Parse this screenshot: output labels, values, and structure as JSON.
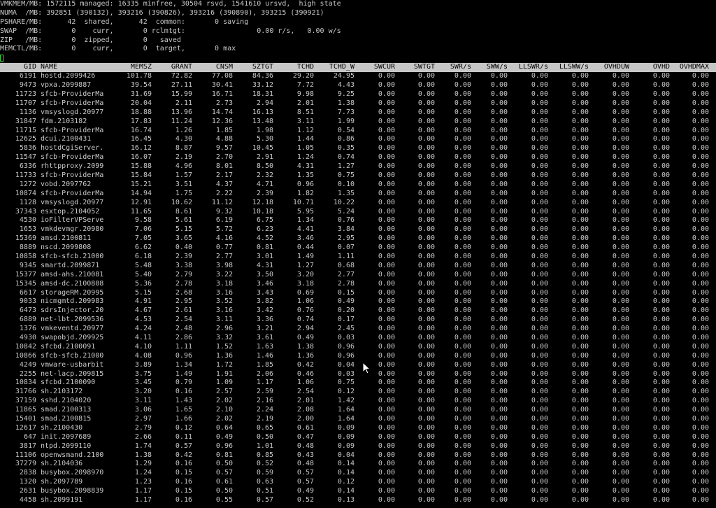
{
  "summary": [
    "VMKMEM/MB: 1572115 managed: 16335 minfree, 30504 rsvd, 1541610 ursvd,  high state",
    "NUMA  /MB: 392851 (390132), 393216 (390826), 393216 (390890), 393215 (390921)",
    "PSHARE/MB:      42  shared,      42  common:       0 saving",
    "SWAP  /MB:       0    curr,       0 rclmtgt:                 0.00 r/s,   0.00 w/s",
    "ZIP   /MB:       0  zipped,       0   saved",
    "MEMCTL/MB:       0    curr,       0  target,       0 max"
  ],
  "columns": [
    "GID",
    "NAME",
    "MEMSZ",
    "GRANT",
    "CNSM",
    "SZTGT",
    "TCHD",
    "TCHD_W",
    "SWCUR",
    "SWTGT",
    "SWR/s",
    "SWW/s",
    "LLSWR/s",
    "LLSWW/s",
    "OVHDUW",
    "OVHD",
    "OVHDMAX"
  ],
  "rows": [
    [
      "6191",
      "hostd.2099426",
      "101.78",
      "72.82",
      "77.08",
      "84.36",
      "29.20",
      "24.95"
    ],
    [
      "9473",
      "vpxa.2099887",
      "39.54",
      "27.11",
      "30.41",
      "33.12",
      "7.72",
      "4.43"
    ],
    [
      "11723",
      "sfcb-ProviderMa",
      "31.69",
      "15.99",
      "16.71",
      "18.31",
      "9.98",
      "9.25"
    ],
    [
      "11707",
      "sfcb-ProviderMa",
      "20.04",
      "2.11",
      "2.73",
      "2.94",
      "2.01",
      "1.38"
    ],
    [
      "1136",
      "vmsyslogd.20977",
      "18.88",
      "13.96",
      "14.74",
      "16.13",
      "8.51",
      "7.73"
    ],
    [
      "31847",
      "fdm.2103182",
      "17.83",
      "11.24",
      "12.36",
      "13.48",
      "3.11",
      "1.99"
    ],
    [
      "11715",
      "sfcb-ProviderMa",
      "16.74",
      "1.26",
      "1.85",
      "1.98",
      "1.12",
      "0.54"
    ],
    [
      "12625",
      "dcui.2100431",
      "16.45",
      "4.30",
      "4.88",
      "5.30",
      "1.44",
      "0.86"
    ],
    [
      "5836",
      "hostdCgiServer.",
      "16.12",
      "8.87",
      "9.57",
      "10.45",
      "1.05",
      "0.35"
    ],
    [
      "11547",
      "sfcb-ProviderMa",
      "16.07",
      "2.19",
      "2.70",
      "2.91",
      "1.24",
      "0.74"
    ],
    [
      "6336",
      "rhttpproxy.2099",
      "15.88",
      "4.96",
      "8.01",
      "8.50",
      "4.31",
      "1.27"
    ],
    [
      "11733",
      "sfcb-ProviderMa",
      "15.84",
      "1.57",
      "2.17",
      "2.32",
      "1.35",
      "0.75"
    ],
    [
      "1272",
      "vobd.2097762",
      "15.21",
      "3.51",
      "4.37",
      "4.71",
      "0.96",
      "0.10"
    ],
    [
      "10874",
      "sfcb-ProviderMa",
      "14.94",
      "1.75",
      "2.22",
      "2.39",
      "1.82",
      "1.35"
    ],
    [
      "1128",
      "vmsyslogd.20977",
      "12.91",
      "10.62",
      "11.12",
      "12.18",
      "10.71",
      "10.22"
    ],
    [
      "37343",
      "esxtop.2104052",
      "11.65",
      "8.61",
      "9.32",
      "10.18",
      "5.95",
      "5.24"
    ],
    [
      "4530",
      "ioFilterVPServe",
      "9.58",
      "5.61",
      "6.19",
      "6.75",
      "1.34",
      "0.76"
    ],
    [
      "1653",
      "vmkdevmgr.20980",
      "7.06",
      "5.15",
      "5.72",
      "6.23",
      "4.41",
      "3.84"
    ],
    [
      "15369",
      "amsd.2100811",
      "7.05",
      "3.65",
      "4.16",
      "4.52",
      "3.46",
      "2.95"
    ],
    [
      "8889",
      "nscd.2099808",
      "6.62",
      "0.40",
      "0.77",
      "0.81",
      "0.44",
      "0.07"
    ],
    [
      "10858",
      "sfcb-sfcb.21000",
      "6.18",
      "2.39",
      "2.77",
      "3.01",
      "1.49",
      "1.11"
    ],
    [
      "9345",
      "smartd.2099871",
      "5.48",
      "3.38",
      "3.98",
      "4.31",
      "1.27",
      "0.68"
    ],
    [
      "15377",
      "amsd-ahs.210081",
      "5.40",
      "2.79",
      "3.22",
      "3.50",
      "3.20",
      "2.77"
    ],
    [
      "15345",
      "amsd-dc.2100808",
      "5.36",
      "2.78",
      "3.18",
      "3.46",
      "3.18",
      "2.78"
    ],
    [
      "6617",
      "storageRM.20995",
      "5.15",
      "2.68",
      "3.16",
      "3.43",
      "0.69",
      "0.15"
    ],
    [
      "9033",
      "nicmgmtd.209983",
      "4.91",
      "2.95",
      "3.52",
      "3.82",
      "1.06",
      "0.49"
    ],
    [
      "6473",
      "sdrsInjector.20",
      "4.67",
      "2.61",
      "3.16",
      "3.42",
      "0.76",
      "0.20"
    ],
    [
      "6889",
      "net-lbt.2099536",
      "4.53",
      "2.54",
      "3.11",
      "3.36",
      "0.74",
      "0.17"
    ],
    [
      "1376",
      "vmkeventd.20977",
      "4.24",
      "2.48",
      "2.96",
      "3.21",
      "2.94",
      "2.45"
    ],
    [
      "4930",
      "swapobjd.209925",
      "4.11",
      "2.86",
      "3.32",
      "3.61",
      "0.49",
      "0.03"
    ],
    [
      "10842",
      "sfcbd.2100091",
      "4.10",
      "1.11",
      "1.52",
      "1.63",
      "1.38",
      "0.96"
    ],
    [
      "10866",
      "sfcb-sfcb.21000",
      "4.08",
      "0.96",
      "1.36",
      "1.46",
      "1.36",
      "0.96"
    ],
    [
      "4249",
      "vmware-usbarbit",
      "3.89",
      "1.34",
      "1.72",
      "1.85",
      "0.42",
      "0.04"
    ],
    [
      "2255",
      "net-lacp.209815",
      "3.75",
      "1.49",
      "1.91",
      "2.06",
      "0.46",
      "0.03"
    ],
    [
      "10834",
      "sfcbd.2100090",
      "3.45",
      "0.79",
      "1.09",
      "1.17",
      "1.06",
      "0.75"
    ],
    [
      "31766",
      "sh.2103172",
      "3.20",
      "0.16",
      "2.57",
      "2.59",
      "2.54",
      "0.12"
    ],
    [
      "37159",
      "sshd.2104020",
      "3.11",
      "1.43",
      "2.02",
      "2.16",
      "2.01",
      "1.42"
    ],
    [
      "11865",
      "smad.2100313",
      "3.06",
      "1.65",
      "2.10",
      "2.24",
      "2.08",
      "1.64"
    ],
    [
      "15401",
      "smad.2100815",
      "2.97",
      "1.66",
      "2.02",
      "2.19",
      "2.00",
      "1.64"
    ],
    [
      "12617",
      "sh.2100430",
      "2.79",
      "0.12",
      "0.64",
      "0.65",
      "0.61",
      "0.09"
    ],
    [
      "647",
      "init.2097689",
      "2.66",
      "0.11",
      "0.49",
      "0.50",
      "0.47",
      "0.09"
    ],
    [
      "3817",
      "ntpd.2099110",
      "1.74",
      "0.57",
      "0.96",
      "1.01",
      "0.48",
      "0.09"
    ],
    [
      "11106",
      "openwsmand.2100",
      "1.38",
      "0.42",
      "0.81",
      "0.85",
      "0.43",
      "0.04"
    ],
    [
      "37279",
      "sh.2104036",
      "1.29",
      "0.16",
      "0.50",
      "0.52",
      "0.48",
      "0.14"
    ],
    [
      "2838",
      "busybox.2098970",
      "1.24",
      "0.15",
      "0.57",
      "0.59",
      "0.57",
      "0.14"
    ],
    [
      "1320",
      "sh.2097789",
      "1.23",
      "0.16",
      "0.61",
      "0.63",
      "0.57",
      "0.12"
    ],
    [
      "2631",
      "busybox.2098839",
      "1.17",
      "0.15",
      "0.50",
      "0.51",
      "0.49",
      "0.14"
    ],
    [
      "4458",
      "sh.2099191",
      "1.17",
      "0.16",
      "0.55",
      "0.57",
      "0.52",
      "0.13"
    ]
  ],
  "zero_value": "0.00",
  "colors": {
    "background": "#000000",
    "text": "#c8c8c8",
    "header_bg": "#c6c6c6",
    "header_text": "#000000",
    "cursor": "#3fd13f"
  },
  "icons": {
    "mouse": "arrow-pointer-icon",
    "terminal_cursor": "block-cursor-icon"
  }
}
